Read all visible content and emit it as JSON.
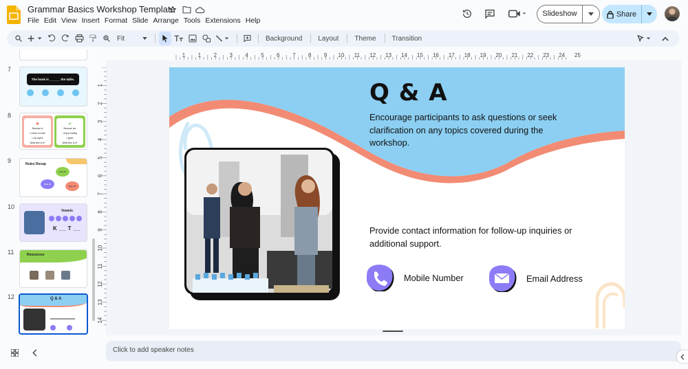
{
  "app": {
    "title": "Grammar Basics Workshop Template",
    "menu": [
      "File",
      "Edit",
      "View",
      "Insert",
      "Format",
      "Slide",
      "Arrange",
      "Tools",
      "Extensions",
      "Help"
    ]
  },
  "header": {
    "slideshow_label": "Slideshow",
    "share_label": "Share"
  },
  "toolbar": {
    "zoom": "Fit",
    "background_label": "Background",
    "layout_label": "Layout",
    "theme_label": "Theme",
    "transition_label": "Transition"
  },
  "ruler": {
    "horizontal": [
      "1",
      "1",
      "2",
      "3",
      "4",
      "5",
      "6",
      "7",
      "8",
      "9",
      "10",
      "11",
      "12",
      "13",
      "14",
      "15",
      "16",
      "17",
      "18",
      "19",
      "20",
      "21",
      "22",
      "23",
      "24",
      "25"
    ],
    "vertical": [
      "1",
      "2",
      "3",
      "4",
      "5",
      "6",
      "7",
      "8",
      "9",
      "10",
      "11",
      "12",
      "13",
      "14"
    ]
  },
  "filmstrip": {
    "selected_number": "12",
    "slides": [
      {
        "number": "7",
        "thumb_text": "The book is ______ the table."
      },
      {
        "number": "8",
        "thumb_text_left": [
          "Because is",
          "I refuse to reset",
          "I can agree",
          "What time is it?"
        ],
        "thumb_text_right": [
          "Because are",
          "I enjoy reading",
          "I agree",
          "What time is it?"
        ]
      },
      {
        "number": "9",
        "thumb_title": "Rules Recap",
        "bubbles": [
          "Rule #1",
          "Rule #2",
          "Rule #3"
        ]
      },
      {
        "number": "10",
        "thumb_title": "Vowels",
        "thumb_text": "K __ T __"
      },
      {
        "number": "11",
        "thumb_title": "Resources"
      },
      {
        "number": "12",
        "thumb_title": "Q & A"
      }
    ]
  },
  "slide": {
    "title": "Q & A",
    "intro": "Encourage participants to ask questions or seek clarification on any topics covered during the workshop.",
    "contact_text": "Provide contact information for follow-up inquiries or additional support.",
    "mobile_label": "Mobile Number",
    "email_label": "Email Address"
  },
  "notes": {
    "placeholder": "Click to add speaker notes"
  },
  "colors": {
    "accent_blue": "#8ccff2",
    "accent_coral": "#f28b74",
    "accent_purple": "#8b7cf6",
    "brand_yellow": "#f4b400",
    "share_bg": "#c2e7ff"
  }
}
